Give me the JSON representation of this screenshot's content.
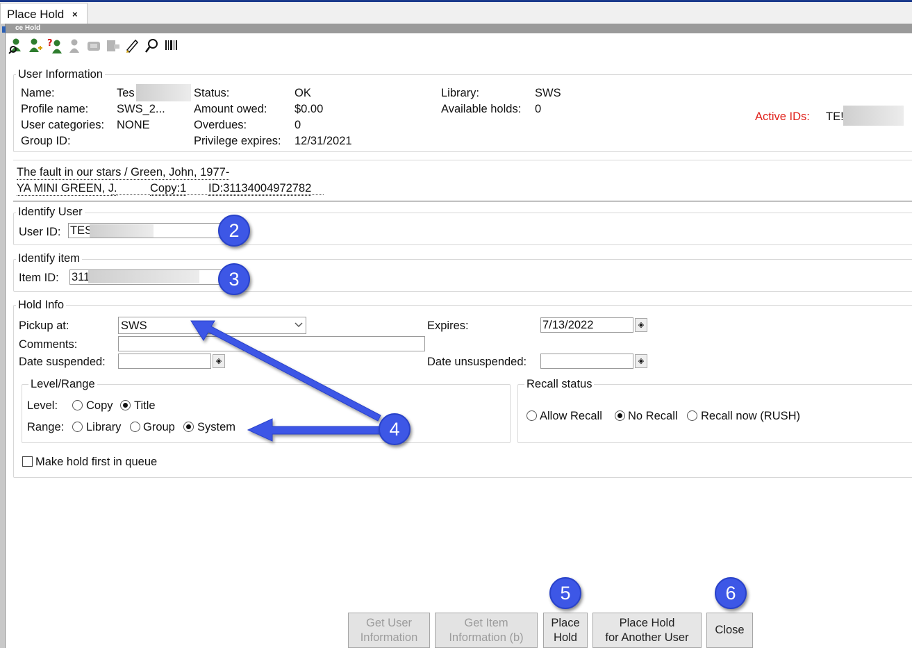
{
  "window": {
    "tab_title": "Place Hold",
    "tab_close": "×",
    "wizard_title_fragment": "ce Hold"
  },
  "toolbar": {
    "icons": [
      "user-search-icon",
      "add-user-icon",
      "user-help-icon",
      "user-disabled-icon",
      "item-disabled-icon",
      "printer-disabled-icon",
      "edit-note-icon",
      "search-item-icon",
      "barcode-icon"
    ]
  },
  "user_info": {
    "legend": "User Information",
    "name_label": "Name:",
    "name_value": "Tes",
    "profile_label": "Profile name:",
    "profile_value": "SWS_2...",
    "categories_label": "User categories:",
    "categories_value": "NONE",
    "group_label": "Group ID:",
    "status_label": "Status:",
    "status_value": "OK",
    "owed_label": "Amount owed:",
    "owed_value": "$0.00",
    "overdues_label": "Overdues:",
    "overdues_value": "0",
    "privilege_label": "Privilege expires:",
    "privilege_value": "12/31/2021",
    "library_label": "Library:",
    "library_value": "SWS",
    "holds_label": "Available holds:",
    "holds_value": "0",
    "active_ids_label": "Active IDs:",
    "active_ids_value": "TE!"
  },
  "item_info": {
    "title_line": "The fault in our stars / Green, John, 1977-",
    "call_number": "YA MINI GREEN, J.",
    "copy": "Copy:1",
    "id": "ID:31134004972782"
  },
  "identify_user": {
    "legend": "Identify User",
    "label": "User ID:",
    "value": "TES"
  },
  "identify_item": {
    "legend": "Identify item",
    "label": "Item ID:",
    "value": "311"
  },
  "hold_info": {
    "legend": "Hold Info",
    "pickup_label": "Pickup at:",
    "pickup_value": "SWS",
    "comments_label": "Comments:",
    "suspended_label": "Date suspended:",
    "expires_label": "Expires:",
    "expires_value": "7/13/2022",
    "unsuspended_label": "Date unsuspended:",
    "level_range": {
      "legend": "Level/Range",
      "level_label": "Level:",
      "level_options": [
        "Copy",
        "Title"
      ],
      "level_selected": "Title",
      "range_label": "Range:",
      "range_options": [
        "Library",
        "Group",
        "System"
      ],
      "range_selected": "System"
    },
    "recall": {
      "legend": "Recall status",
      "options": [
        "Allow Recall",
        "No Recall",
        "Recall now (RUSH)"
      ],
      "selected": "No Recall"
    },
    "first_in_queue_label": "Make hold first in queue"
  },
  "buttons": {
    "get_user_info": [
      "Get User",
      "Information"
    ],
    "get_item_info": [
      "Get Item",
      "Information (b)"
    ],
    "place_hold": [
      "Place",
      "Hold"
    ],
    "place_hold_other": [
      "Place Hold",
      "for Another User"
    ],
    "close": "Close"
  },
  "annotations": [
    "2",
    "3",
    "4",
    "5",
    "6"
  ],
  "colors": {
    "annotation_blue": "#3d57e6",
    "active_ids_red": "#e0201a",
    "title_bar": "#1b3a8c"
  }
}
